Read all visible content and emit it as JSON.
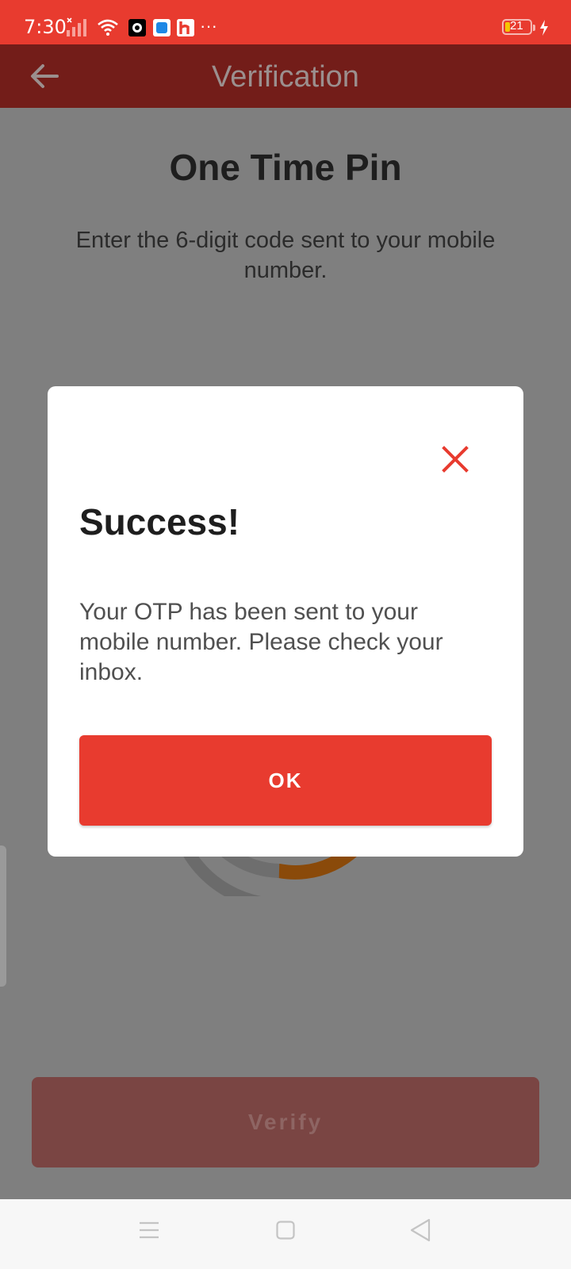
{
  "status_bar": {
    "time": "7:30",
    "battery_level": "21",
    "more_indicator": "···",
    "icons": [
      "signal-icon",
      "wifi-icon",
      "app-notification-icon",
      "app-notification-icon",
      "app-notification-icon",
      "charging-icon"
    ]
  },
  "app_bar": {
    "title": "Verification",
    "back_icon": "arrow-left-icon"
  },
  "page": {
    "heading": "One Time Pin",
    "subtitle": "Enter the 6-digit code sent to your mobile number.",
    "verify_label": "Verify"
  },
  "modal": {
    "title": "Success!",
    "message": "Your OTP has been sent to your mobile number. Please check your inbox.",
    "ok_label": "OK",
    "close_icon": "close-icon"
  },
  "nav_bar": {
    "icons": [
      "menu-icon",
      "home-square-icon",
      "back-triangle-icon"
    ]
  },
  "colors": {
    "accent": "#e83b2f",
    "app_bar_dimmed": "#731d19",
    "overlay": "#7f7f7f",
    "timer_arc": "#8a4a0a"
  }
}
